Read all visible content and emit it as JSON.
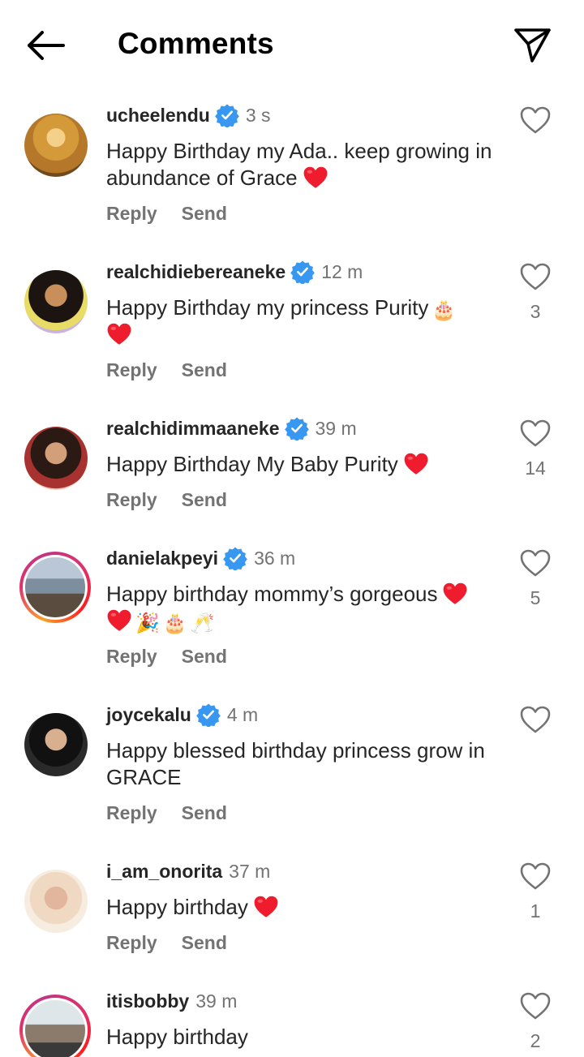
{
  "header": {
    "title": "Comments",
    "back_icon": "arrow-left-icon",
    "share_icon": "paper-plane-icon"
  },
  "actions": {
    "reply": "Reply",
    "send": "Send"
  },
  "comments": [
    {
      "username": "ucheelendu",
      "verified": true,
      "time": "3 s",
      "text": "Happy Birthday my Ada.. keep growing in abundance of Grace",
      "emojis": [
        "red-heart"
      ],
      "likes": ""
    },
    {
      "username": "realchidiebereaneke",
      "verified": true,
      "time": "12 m",
      "text": "Happy Birthday my princess Purity",
      "emojis": [
        "birthday-cake",
        "red-heart"
      ],
      "likes": "3"
    },
    {
      "username": "realchidimmaaneke",
      "verified": true,
      "time": "39 m",
      "text": "Happy Birthday My Baby Purity",
      "emojis": [
        "red-heart"
      ],
      "likes": "14"
    },
    {
      "username": "danielakpeyi",
      "verified": true,
      "time": "36 m",
      "text": "Happy birthday mommy’s gorgeous",
      "emojis": [
        "red-heart",
        "red-heart",
        "party-popper",
        "birthday-cake",
        "clinking-glasses"
      ],
      "likes": "5"
    },
    {
      "username": "joycekalu",
      "verified": true,
      "time": "4 m",
      "text": "Happy blessed birthday princess grow in GRACE",
      "emojis": [],
      "likes": ""
    },
    {
      "username": "i_am_onorita",
      "verified": false,
      "time": "37 m",
      "text": "Happy birthday",
      "emojis": [
        "red-heart"
      ],
      "likes": "1"
    },
    {
      "username": "itisbobby",
      "verified": false,
      "time": "39 m",
      "text": "Happy birthday",
      "emojis": [],
      "likes": "2"
    }
  ],
  "colors": {
    "verified": "#3897f0",
    "secondary_text": "#737373",
    "heart": "#ef1c2e"
  }
}
